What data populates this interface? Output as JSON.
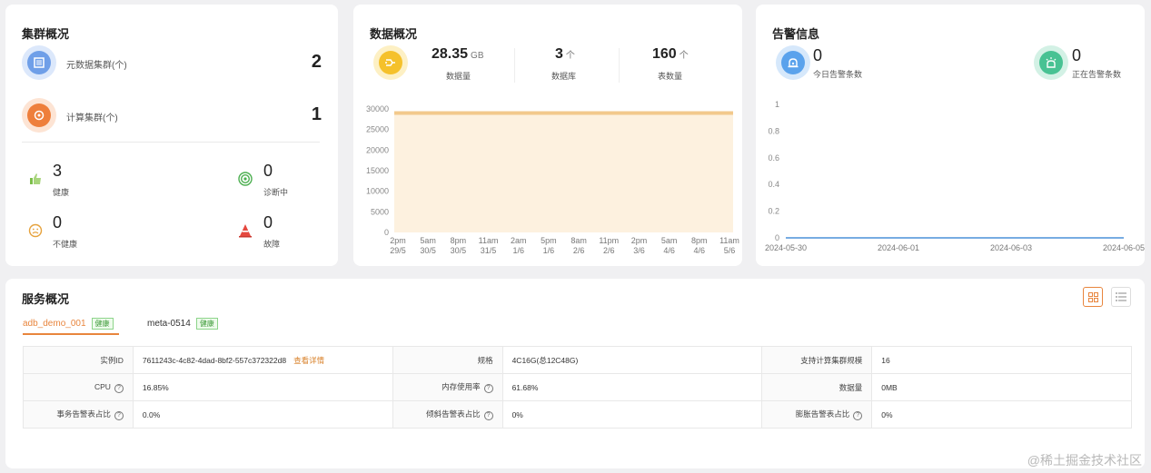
{
  "cluster": {
    "title": "集群概况",
    "meta_label": "元数据集群(个)",
    "meta_value": "2",
    "compute_label": "计算集群(个)",
    "compute_value": "1",
    "stats": [
      {
        "value": "3",
        "label": "健康",
        "icon": "thumbs-up-icon",
        "color": "#7cbf4a"
      },
      {
        "value": "0",
        "label": "诊断中",
        "icon": "radar-icon",
        "color": "#4caf50"
      },
      {
        "value": "0",
        "label": "不健康",
        "icon": "sad-face-icon",
        "color": "#e6a23c"
      },
      {
        "value": "0",
        "label": "故障",
        "icon": "warning-cone-icon",
        "color": "#e5483f"
      }
    ]
  },
  "data_overview": {
    "title": "数据概况",
    "metrics": [
      {
        "value": "28.35",
        "unit": "GB",
        "label": "数据量"
      },
      {
        "value": "3",
        "unit": "个",
        "label": "数据库"
      },
      {
        "value": "160",
        "unit": "个",
        "label": "表数量"
      }
    ]
  },
  "alert": {
    "title": "告警信息",
    "today_value": "0",
    "today_label": "今日告警条数",
    "active_value": "0",
    "active_label": "正在告警条数"
  },
  "service": {
    "title": "服务概况",
    "tabs": [
      {
        "label": "adb_demo_001",
        "badge": "健康"
      },
      {
        "label": "meta-0514",
        "badge": "健康"
      }
    ],
    "rows": [
      [
        {
          "label": "实例ID",
          "value": "7611243c-4c82-4dad-8bf2-557c372322d8",
          "link": "查看详情"
        },
        {
          "label": "规格",
          "value": "4C16G(总12C48G)"
        },
        {
          "label": "支持计算集群规模",
          "value": "16"
        }
      ],
      [
        {
          "label": "CPU",
          "value": "16.85%",
          "help": true
        },
        {
          "label": "内存使用率",
          "value": "61.68%",
          "help": true
        },
        {
          "label": "数据量",
          "value": "0MB"
        }
      ],
      [
        {
          "label": "事务告警表占比",
          "value": "0.0%",
          "help": true
        },
        {
          "label": "倾斜告警表占比",
          "value": "0%",
          "help": true
        },
        {
          "label": "膨胀告警表占比",
          "value": "0%",
          "help": true
        }
      ]
    ]
  },
  "watermark": "@稀土掘金技术社区",
  "colors": {
    "accent": "#e8853d",
    "area_fill": "#fdf1df",
    "area_line": "#f2c98c",
    "alert_line": "#4a90d9"
  },
  "chart_data": [
    {
      "type": "area",
      "x": [
        "2pm 29/5",
        "5am 30/5",
        "8pm 30/5",
        "11am 31/5",
        "2am 1/6",
        "5pm 1/6",
        "8am 2/6",
        "11pm 2/6",
        "2pm 3/6",
        "5am 4/6",
        "8pm 4/6",
        "11am 5/6"
      ],
      "series": [
        {
          "values": [
            29000,
            29000,
            29000,
            29000,
            29000,
            29000,
            29000,
            29000,
            29000,
            29000,
            29000,
            29000
          ]
        }
      ],
      "ylim": [
        0,
        30000
      ],
      "yticks": [
        "30000",
        "25000",
        "20000",
        "15000",
        "10000",
        "5000",
        "0"
      ]
    },
    {
      "type": "line",
      "x": [
        "2024-05-30",
        "2024-06-01",
        "2024-06-03",
        "2024-06-05"
      ],
      "series": [
        {
          "values": [
            0,
            0,
            0,
            0
          ]
        }
      ],
      "ylim": [
        0,
        1
      ],
      "yticks": [
        "1",
        "0.8",
        "0.6",
        "0.4",
        "0.2",
        "0"
      ]
    }
  ]
}
